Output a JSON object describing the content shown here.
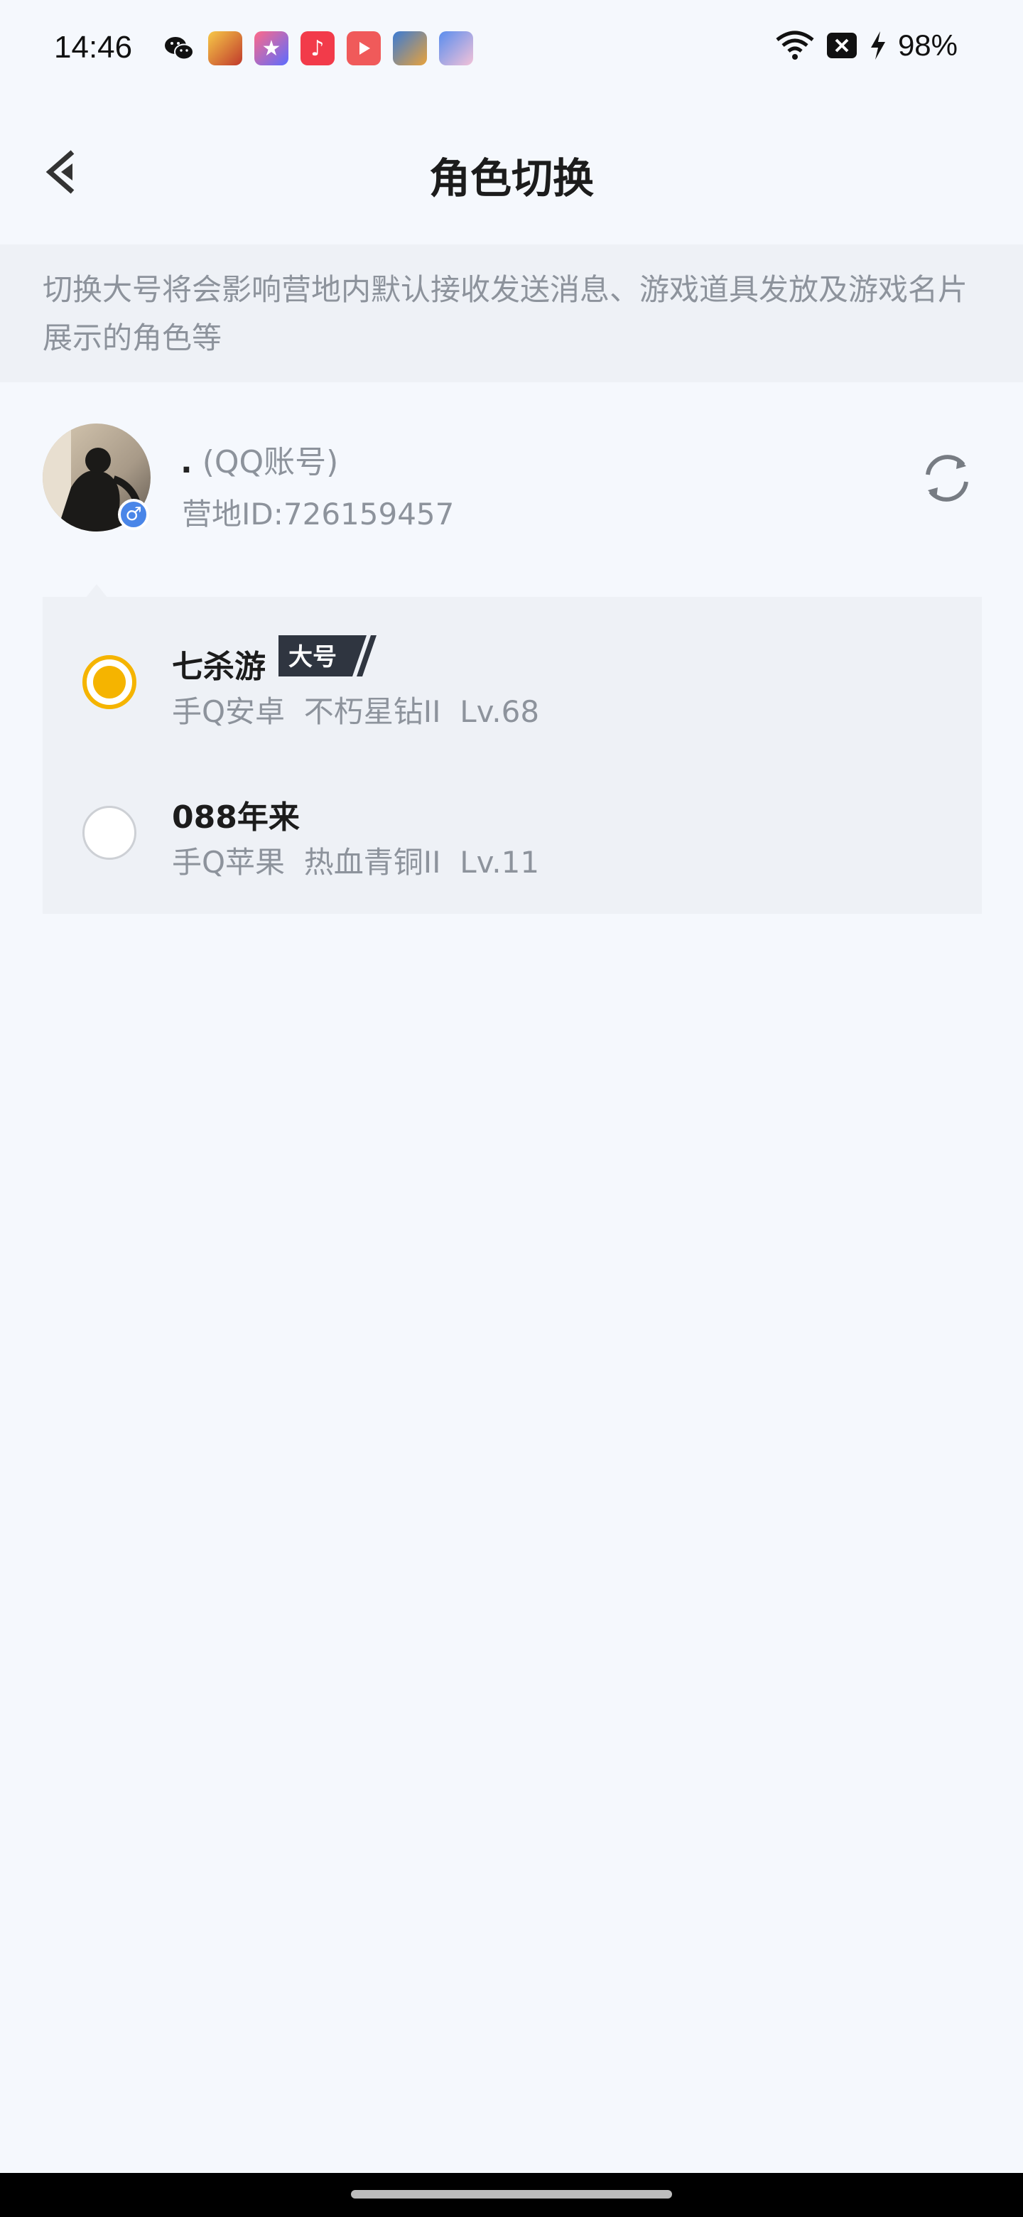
{
  "status_bar": {
    "time": "14:46",
    "battery": "98%",
    "app_icons": [
      "wechat-icon",
      "game-icon",
      "star-app-icon",
      "music-icon",
      "video-icon",
      "game-hero-icon",
      "game-anime-icon"
    ]
  },
  "nav": {
    "back_icon": "chevron-left-icon",
    "title": "角色切换"
  },
  "notice": {
    "text": "切换大号将会影响营地内默认接收发送消息、游戏道具发放及游戏名片展示的角色等"
  },
  "account": {
    "name_prefix": ".",
    "name_suffix": "(QQ账号)",
    "id_text": "营地ID:726159457",
    "gender_symbol": "♂",
    "refresh_icon": "refresh-icon"
  },
  "roles": [
    {
      "name": "七杀游",
      "tag": "大号",
      "platform": "手Q安卓",
      "rank": "不朽星钻II",
      "level": "Lv.68",
      "selected": true
    },
    {
      "name": "088年来",
      "platform": "手Q苹果",
      "rank": "热血青铜II",
      "level": "Lv.11",
      "selected": false
    }
  ],
  "colors": {
    "accent": "#f5b400",
    "background": "#f5f8fd",
    "card": "#eef1f6",
    "muted_text": "#8d939c"
  }
}
